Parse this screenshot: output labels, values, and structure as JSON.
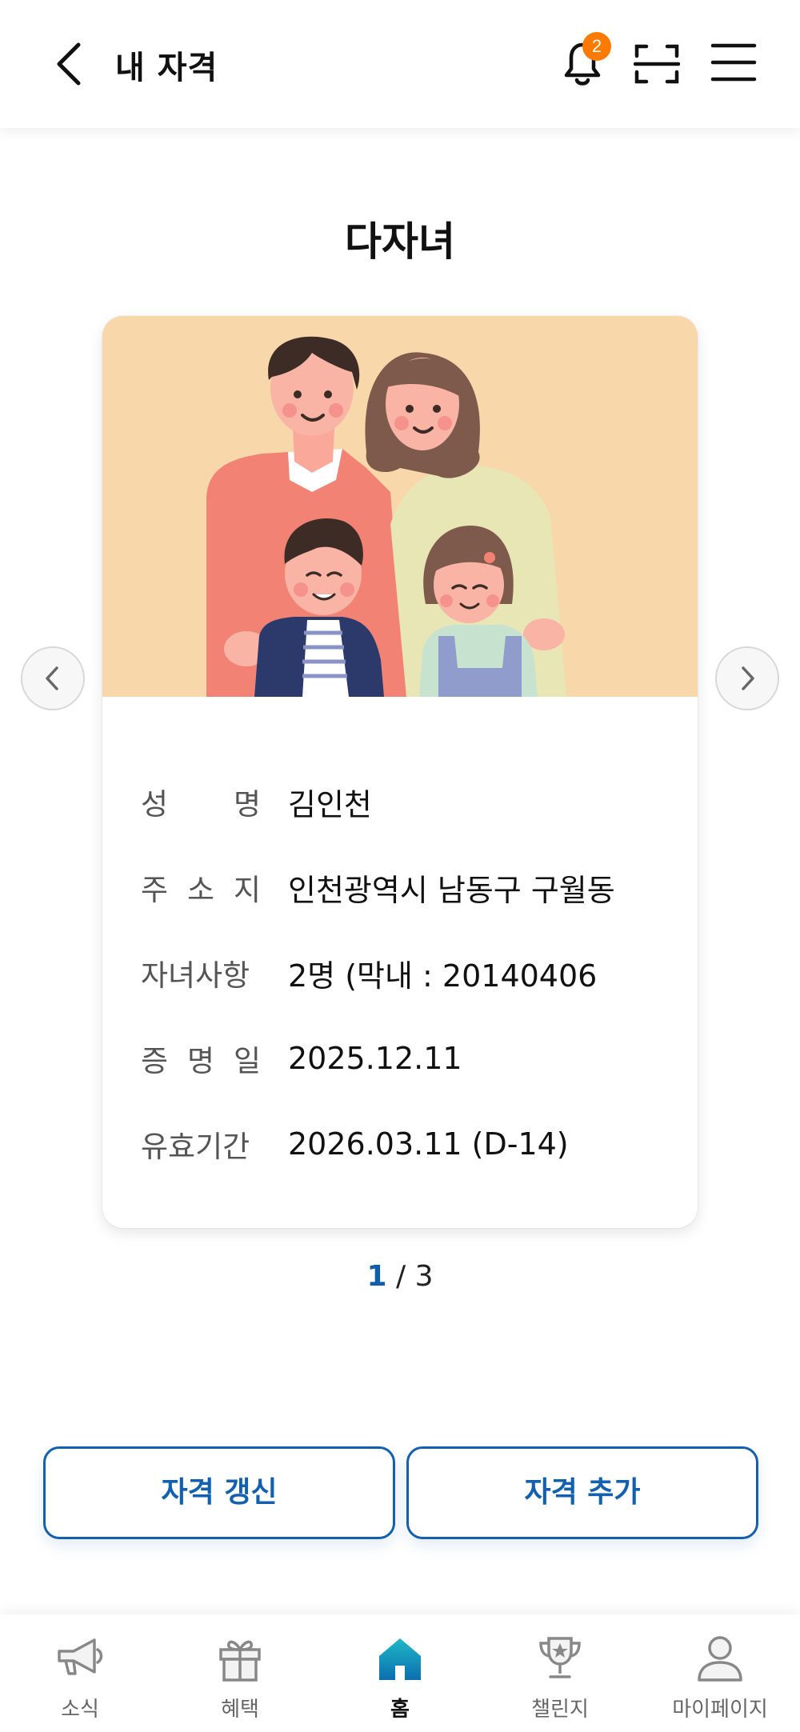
{
  "header": {
    "title": "내 자격",
    "notification_count": "2"
  },
  "section": {
    "title": "다자녀"
  },
  "card": {
    "fields": [
      {
        "label_chars": [
          "성",
          "명"
        ],
        "value": "김인천"
      },
      {
        "label_chars": [
          "주",
          "소",
          "지"
        ],
        "value": "인천광역시 남동구 구월동"
      },
      {
        "label_chars": [
          "자녀사항"
        ],
        "value": "2명 (막내 : 20140406"
      },
      {
        "label_chars": [
          "증",
          "명",
          "일"
        ],
        "value": "2025.12.11"
      },
      {
        "label_chars": [
          "유효기간"
        ],
        "value": "2026.03.11 (D-14)"
      }
    ]
  },
  "pager": {
    "current": "1",
    "separator": " / ",
    "total": "3"
  },
  "actions": {
    "renew_label": "자격 갱신",
    "add_label": "자격 추가"
  },
  "nav": {
    "items": [
      {
        "label": "소식",
        "icon": "megaphone-icon"
      },
      {
        "label": "혜택",
        "icon": "gift-icon"
      },
      {
        "label": "홈",
        "icon": "home-icon"
      },
      {
        "label": "챌린지",
        "icon": "trophy-icon"
      },
      {
        "label": "마이페이지",
        "icon": "person-icon"
      }
    ],
    "active_index": 2
  },
  "colors": {
    "accent": "#1460b0",
    "badge": "#ff7a00",
    "illustration_bg": "#f8d7aa"
  }
}
